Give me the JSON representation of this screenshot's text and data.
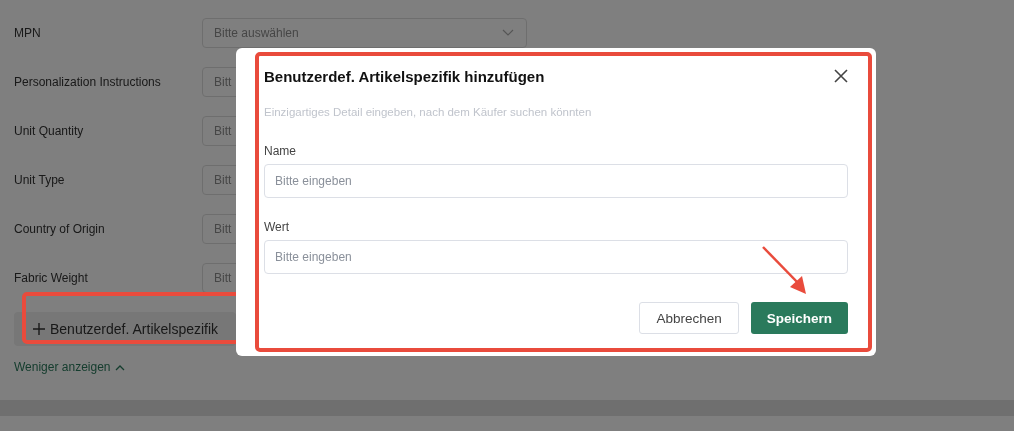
{
  "form": {
    "rows": [
      {
        "label": "MPN",
        "kind": "select",
        "placeholder": "Bitte auswählen"
      },
      {
        "label": "Personalization Instructions",
        "kind": "input",
        "placeholder": "Bitt"
      },
      {
        "label": "Unit Quantity",
        "kind": "input",
        "placeholder": "Bitt"
      },
      {
        "label": "Unit Type",
        "kind": "input",
        "placeholder": "Bitt"
      },
      {
        "label": "Country of Origin",
        "kind": "input",
        "placeholder": "Bitt"
      },
      {
        "label": "Fabric Weight",
        "kind": "input",
        "placeholder": "Bitt"
      }
    ],
    "add_button": "Benutzerdef. Artikelspezifik",
    "toggle_link": "Weniger anzeigen"
  },
  "dialog": {
    "title": "Benutzerdef. Artikelspezifik hinzufügen",
    "hint": "Einzigartiges Detail eingeben, nach dem Käufer suchen könnten",
    "fields": [
      {
        "label": "Name",
        "placeholder": "Bitte eingeben"
      },
      {
        "label": "Wert",
        "placeholder": "Bitte eingeben"
      }
    ],
    "buttons": [
      {
        "label": "Abbrechen",
        "kind": "secondary"
      },
      {
        "label": "Speichern",
        "kind": "primary"
      }
    ]
  }
}
